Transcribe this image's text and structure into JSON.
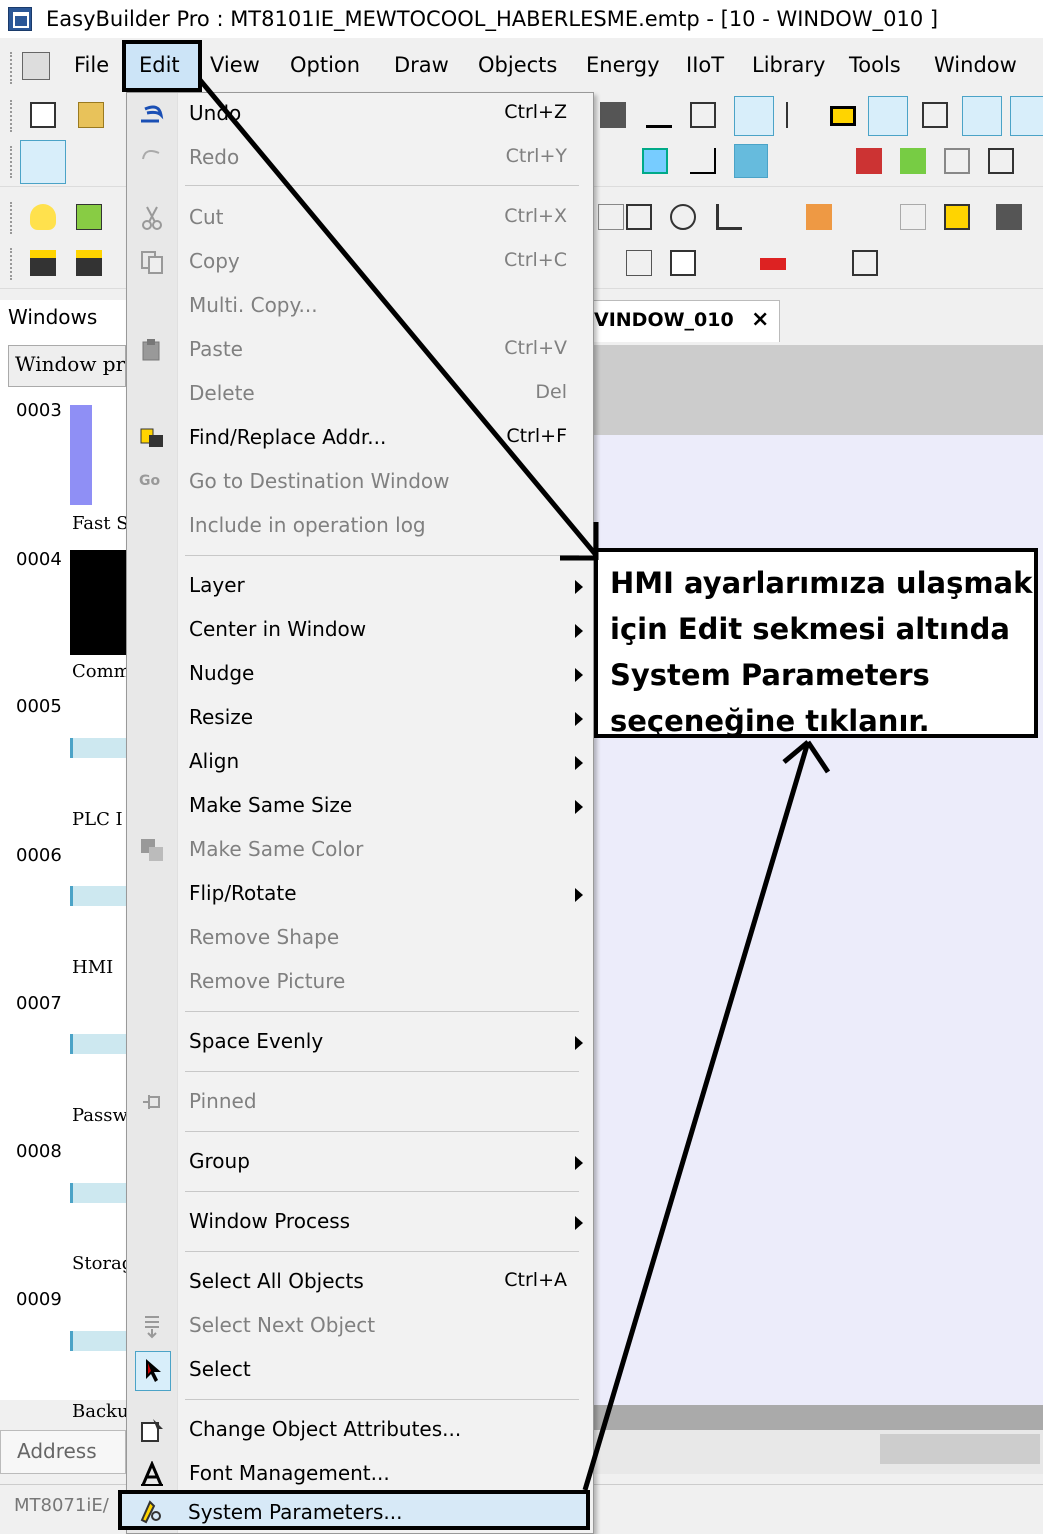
{
  "window": {
    "title": "EasyBuilder Pro : MT8101IE_MEWTOCOOL_HABERLESME.emtp - [10 - WINDOW_010 ]"
  },
  "menubar": {
    "items": [
      "File",
      "Edit",
      "View",
      "Option",
      "Draw",
      "Objects",
      "Energy",
      "IIoT",
      "Library",
      "Tools",
      "Window"
    ]
  },
  "left_panel": {
    "title": "Windows",
    "property_button": "Window pr",
    "windows": [
      {
        "num": "0003",
        "label": "Fast S"
      },
      {
        "num": "0004",
        "label": "Comm"
      },
      {
        "num": "0005",
        "label": "PLC I"
      },
      {
        "num": "0006",
        "label": "HMI"
      },
      {
        "num": "0007",
        "label": "Passw"
      },
      {
        "num": "0008",
        "label": "Storag"
      },
      {
        "num": "0009",
        "label": "Backu"
      }
    ]
  },
  "tab": {
    "label": "VINDOW_010",
    "close": "×"
  },
  "bottom": {
    "address_tab": "Address",
    "status_text": "MT8071iE/"
  },
  "edit_menu": {
    "items": [
      {
        "label": "Undo",
        "shortcut": "Ctrl+Z",
        "enabled": true
      },
      {
        "label": "Redo",
        "shortcut": "Ctrl+Y",
        "enabled": false
      },
      {
        "label": "Cut",
        "shortcut": "Ctrl+X",
        "enabled": false
      },
      {
        "label": "Copy",
        "shortcut": "Ctrl+C",
        "enabled": false
      },
      {
        "label": "Multi. Copy...",
        "shortcut": "",
        "enabled": false
      },
      {
        "label": "Paste",
        "shortcut": "Ctrl+V",
        "enabled": false
      },
      {
        "label": "Delete",
        "shortcut": "Del",
        "enabled": false
      },
      {
        "label": "Find/Replace Addr...",
        "shortcut": "Ctrl+F",
        "enabled": true
      },
      {
        "label": "Go to Destination Window",
        "shortcut": "",
        "enabled": false
      },
      {
        "label": "Include in operation log",
        "shortcut": "",
        "enabled": false
      },
      {
        "label": "Layer",
        "shortcut": "",
        "enabled": true,
        "submenu": true
      },
      {
        "label": "Center in Window",
        "shortcut": "",
        "enabled": true,
        "submenu": true
      },
      {
        "label": "Nudge",
        "shortcut": "",
        "enabled": true,
        "submenu": true
      },
      {
        "label": "Resize",
        "shortcut": "",
        "enabled": true,
        "submenu": true
      },
      {
        "label": "Align",
        "shortcut": "",
        "enabled": true,
        "submenu": true
      },
      {
        "label": "Make Same Size",
        "shortcut": "",
        "enabled": true,
        "submenu": true
      },
      {
        "label": "Make Same Color",
        "shortcut": "",
        "enabled": false
      },
      {
        "label": "Flip/Rotate",
        "shortcut": "",
        "enabled": true,
        "submenu": true
      },
      {
        "label": "Remove Shape",
        "shortcut": "",
        "enabled": false
      },
      {
        "label": "Remove Picture",
        "shortcut": "",
        "enabled": false
      },
      {
        "label": "Space Evenly",
        "shortcut": "",
        "enabled": true,
        "submenu": true
      },
      {
        "label": "Pinned",
        "shortcut": "",
        "enabled": false
      },
      {
        "label": "Group",
        "shortcut": "",
        "enabled": true,
        "submenu": true
      },
      {
        "label": "Window Process",
        "shortcut": "",
        "enabled": true,
        "submenu": true
      },
      {
        "label": "Select All Objects",
        "shortcut": "Ctrl+A",
        "enabled": true
      },
      {
        "label": "Select Next Object",
        "shortcut": "",
        "enabled": false
      },
      {
        "label": "Select",
        "shortcut": "",
        "enabled": true
      },
      {
        "label": "Change Object Attributes...",
        "shortcut": "",
        "enabled": true
      },
      {
        "label": "Font Management...",
        "shortcut": "",
        "enabled": true
      },
      {
        "label": "System Parameters...",
        "shortcut": "",
        "enabled": true
      }
    ]
  },
  "annotation": {
    "lines": [
      "HMI ayarlarımıza ulaşmak",
      "için Edit sekmesi altında",
      "System Parameters",
      "seçeneğine tıklanır."
    ]
  }
}
